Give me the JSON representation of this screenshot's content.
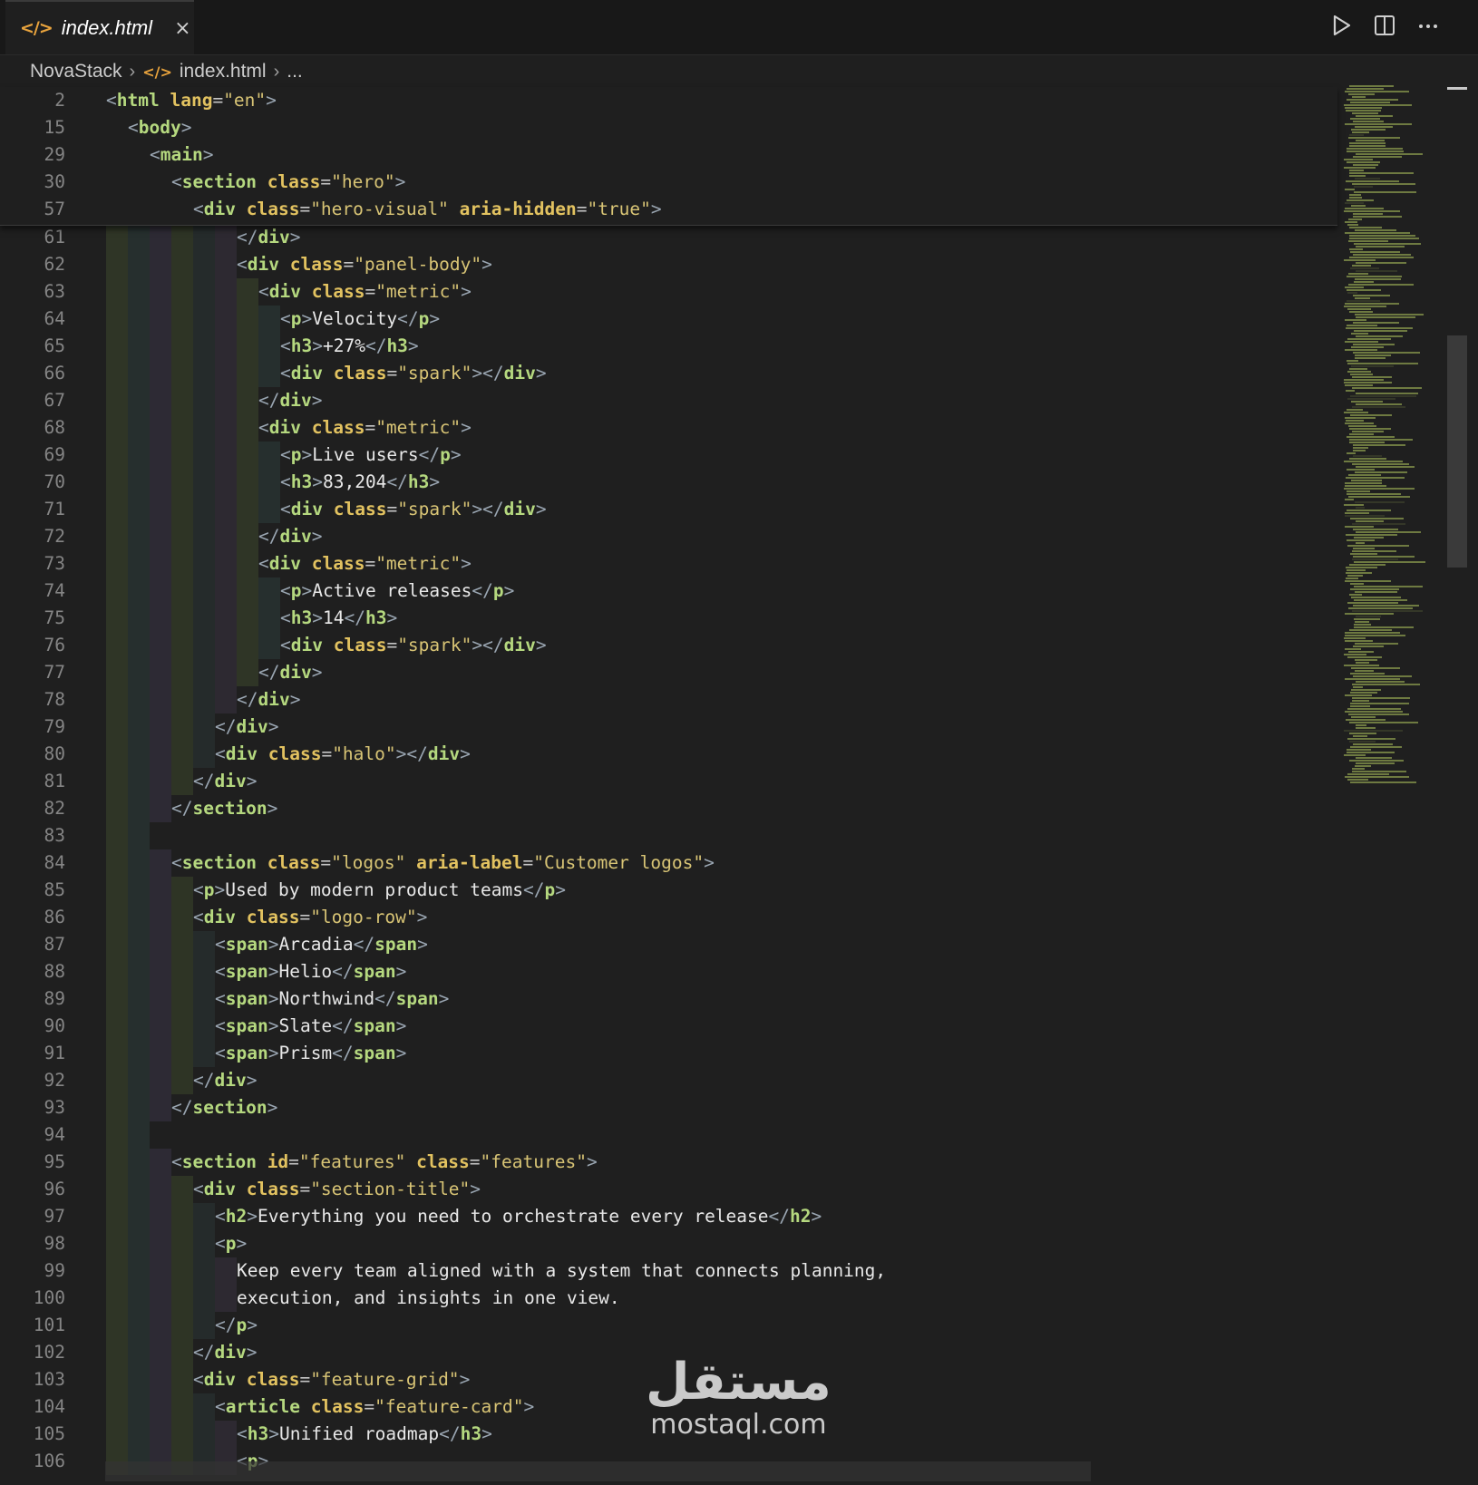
{
  "tab": {
    "icon": "html-file-icon",
    "label": "index.html",
    "close": "×"
  },
  "breadcrumb": {
    "project": "NovaStack",
    "file": "index.html",
    "more": "..."
  },
  "actions": [
    "run-icon",
    "split-editor-icon",
    "more-actions-icon"
  ],
  "sticky_lines": [
    {
      "n": "2",
      "html": "<span class='br'>&lt;</span><span class='tag'>html</span> <span class='at'>lang</span><span class='eq'>=</span><span class='st'>\"en\"</span><span class='br'>&gt;</span>",
      "indent": 0
    },
    {
      "n": "15",
      "html": "<span class='br'>&lt;</span><span class='tag'>body</span><span class='br'>&gt;</span>",
      "indent": 1
    },
    {
      "n": "29",
      "html": "<span class='br'>&lt;</span><span class='tag'>main</span><span class='br'>&gt;</span>",
      "indent": 2
    },
    {
      "n": "30",
      "html": "<span class='br'>&lt;</span><span class='tag'>section</span> <span class='at'>class</span><span class='eq'>=</span><span class='st'>\"hero\"</span><span class='br'>&gt;</span>",
      "indent": 3
    },
    {
      "n": "57",
      "html": "<span class='br'>&lt;</span><span class='tag'>div</span> <span class='at'>class</span><span class='eq'>=</span><span class='st'>\"hero-visual\"</span> <span class='at'>aria-hidden</span><span class='eq'>=</span><span class='st'>\"true\"</span><span class='br'>&gt;</span>",
      "indent": 4
    }
  ],
  "lines": [
    {
      "n": "61",
      "indent": 6,
      "guides": 6,
      "html": "<span class='br'>&lt;/</span><span class='tag'>div</span><span class='br'>&gt;</span>"
    },
    {
      "n": "62",
      "indent": 6,
      "guides": 6,
      "html": "<span class='br'>&lt;</span><span class='tag'>div</span> <span class='at'>class</span><span class='eq'>=</span><span class='st'>\"panel-body\"</span><span class='br'>&gt;</span>"
    },
    {
      "n": "63",
      "indent": 7,
      "guides": 7,
      "html": "<span class='br'>&lt;</span><span class='tag'>div</span> <span class='at'>class</span><span class='eq'>=</span><span class='st'>\"metric\"</span><span class='br'>&gt;</span>"
    },
    {
      "n": "64",
      "indent": 8,
      "guides": 8,
      "html": "<span class='br'>&lt;</span><span class='tag'>p</span><span class='br'>&gt;</span><span class='tx'>Velocity</span><span class='br'>&lt;/</span><span class='tag'>p</span><span class='br'>&gt;</span>"
    },
    {
      "n": "65",
      "indent": 8,
      "guides": 8,
      "html": "<span class='br'>&lt;</span><span class='tag'>h3</span><span class='br'>&gt;</span><span class='tx'>+27%</span><span class='br'>&lt;/</span><span class='tag'>h3</span><span class='br'>&gt;</span>"
    },
    {
      "n": "66",
      "indent": 8,
      "guides": 8,
      "html": "<span class='br'>&lt;</span><span class='tag'>div</span> <span class='at'>class</span><span class='eq'>=</span><span class='st'>\"spark\"</span><span class='br'>&gt;&lt;/</span><span class='tag'>div</span><span class='br'>&gt;</span>"
    },
    {
      "n": "67",
      "indent": 7,
      "guides": 7,
      "html": "<span class='br'>&lt;/</span><span class='tag'>div</span><span class='br'>&gt;</span>"
    },
    {
      "n": "68",
      "indent": 7,
      "guides": 7,
      "html": "<span class='br'>&lt;</span><span class='tag'>div</span> <span class='at'>class</span><span class='eq'>=</span><span class='st'>\"metric\"</span><span class='br'>&gt;</span>"
    },
    {
      "n": "69",
      "indent": 8,
      "guides": 8,
      "html": "<span class='br'>&lt;</span><span class='tag'>p</span><span class='br'>&gt;</span><span class='tx'>Live users</span><span class='br'>&lt;/</span><span class='tag'>p</span><span class='br'>&gt;</span>"
    },
    {
      "n": "70",
      "indent": 8,
      "guides": 8,
      "html": "<span class='br'>&lt;</span><span class='tag'>h3</span><span class='br'>&gt;</span><span class='tx'>83,204</span><span class='br'>&lt;/</span><span class='tag'>h3</span><span class='br'>&gt;</span>"
    },
    {
      "n": "71",
      "indent": 8,
      "guides": 8,
      "html": "<span class='br'>&lt;</span><span class='tag'>div</span> <span class='at'>class</span><span class='eq'>=</span><span class='st'>\"spark\"</span><span class='br'>&gt;&lt;/</span><span class='tag'>div</span><span class='br'>&gt;</span>"
    },
    {
      "n": "72",
      "indent": 7,
      "guides": 7,
      "html": "<span class='br'>&lt;/</span><span class='tag'>div</span><span class='br'>&gt;</span>"
    },
    {
      "n": "73",
      "indent": 7,
      "guides": 7,
      "html": "<span class='br'>&lt;</span><span class='tag'>div</span> <span class='at'>class</span><span class='eq'>=</span><span class='st'>\"metric\"</span><span class='br'>&gt;</span>"
    },
    {
      "n": "74",
      "indent": 8,
      "guides": 8,
      "html": "<span class='br'>&lt;</span><span class='tag'>p</span><span class='br'>&gt;</span><span class='tx'>Active releases</span><span class='br'>&lt;/</span><span class='tag'>p</span><span class='br'>&gt;</span>"
    },
    {
      "n": "75",
      "indent": 8,
      "guides": 8,
      "html": "<span class='br'>&lt;</span><span class='tag'>h3</span><span class='br'>&gt;</span><span class='tx'>14</span><span class='br'>&lt;/</span><span class='tag'>h3</span><span class='br'>&gt;</span>"
    },
    {
      "n": "76",
      "indent": 8,
      "guides": 8,
      "html": "<span class='br'>&lt;</span><span class='tag'>div</span> <span class='at'>class</span><span class='eq'>=</span><span class='st'>\"spark\"</span><span class='br'>&gt;&lt;/</span><span class='tag'>div</span><span class='br'>&gt;</span>"
    },
    {
      "n": "77",
      "indent": 7,
      "guides": 7,
      "html": "<span class='br'>&lt;/</span><span class='tag'>div</span><span class='br'>&gt;</span>"
    },
    {
      "n": "78",
      "indent": 6,
      "guides": 6,
      "html": "<span class='br'>&lt;/</span><span class='tag'>div</span><span class='br'>&gt;</span>"
    },
    {
      "n": "79",
      "indent": 5,
      "guides": 5,
      "html": "<span class='br'>&lt;/</span><span class='tag'>div</span><span class='br'>&gt;</span>"
    },
    {
      "n": "80",
      "indent": 5,
      "guides": 5,
      "html": "<span class='br'>&lt;</span><span class='tag'>div</span> <span class='at'>class</span><span class='eq'>=</span><span class='st'>\"halo\"</span><span class='br'>&gt;&lt;/</span><span class='tag'>div</span><span class='br'>&gt;</span>"
    },
    {
      "n": "81",
      "indent": 4,
      "guides": 4,
      "html": "<span class='br'>&lt;/</span><span class='tag'>div</span><span class='br'>&gt;</span>"
    },
    {
      "n": "82",
      "indent": 3,
      "guides": 3,
      "html": "<span class='br'>&lt;/</span><span class='tag'>section</span><span class='br'>&gt;</span>"
    },
    {
      "n": "83",
      "indent": 0,
      "guides": 2,
      "html": ""
    },
    {
      "n": "84",
      "indent": 3,
      "guides": 3,
      "html": "<span class='br'>&lt;</span><span class='tag'>section</span> <span class='at'>class</span><span class='eq'>=</span><span class='st'>\"logos\"</span> <span class='at'>aria-label</span><span class='eq'>=</span><span class='st'>\"Customer logos\"</span><span class='br'>&gt;</span>"
    },
    {
      "n": "85",
      "indent": 4,
      "guides": 4,
      "html": "<span class='br'>&lt;</span><span class='tag'>p</span><span class='br'>&gt;</span><span class='tx'>Used by modern product teams</span><span class='br'>&lt;/</span><span class='tag'>p</span><span class='br'>&gt;</span>"
    },
    {
      "n": "86",
      "indent": 4,
      "guides": 4,
      "html": "<span class='br'>&lt;</span><span class='tag'>div</span> <span class='at'>class</span><span class='eq'>=</span><span class='st'>\"logo-row\"</span><span class='br'>&gt;</span>"
    },
    {
      "n": "87",
      "indent": 5,
      "guides": 5,
      "html": "<span class='br'>&lt;</span><span class='tag'>span</span><span class='br'>&gt;</span><span class='tx'>Arcadia</span><span class='br'>&lt;/</span><span class='tag'>span</span><span class='br'>&gt;</span>"
    },
    {
      "n": "88",
      "indent": 5,
      "guides": 5,
      "html": "<span class='br'>&lt;</span><span class='tag'>span</span><span class='br'>&gt;</span><span class='tx'>Helio</span><span class='br'>&lt;/</span><span class='tag'>span</span><span class='br'>&gt;</span>"
    },
    {
      "n": "89",
      "indent": 5,
      "guides": 5,
      "html": "<span class='br'>&lt;</span><span class='tag'>span</span><span class='br'>&gt;</span><span class='tx'>Northwind</span><span class='br'>&lt;/</span><span class='tag'>span</span><span class='br'>&gt;</span>"
    },
    {
      "n": "90",
      "indent": 5,
      "guides": 5,
      "html": "<span class='br'>&lt;</span><span class='tag'>span</span><span class='br'>&gt;</span><span class='tx'>Slate</span><span class='br'>&lt;/</span><span class='tag'>span</span><span class='br'>&gt;</span>"
    },
    {
      "n": "91",
      "indent": 5,
      "guides": 5,
      "html": "<span class='br'>&lt;</span><span class='tag'>span</span><span class='br'>&gt;</span><span class='tx'>Prism</span><span class='br'>&lt;/</span><span class='tag'>span</span><span class='br'>&gt;</span>"
    },
    {
      "n": "92",
      "indent": 4,
      "guides": 4,
      "html": "<span class='br'>&lt;/</span><span class='tag'>div</span><span class='br'>&gt;</span>"
    },
    {
      "n": "93",
      "indent": 3,
      "guides": 3,
      "html": "<span class='br'>&lt;/</span><span class='tag'>section</span><span class='br'>&gt;</span>"
    },
    {
      "n": "94",
      "indent": 0,
      "guides": 2,
      "html": ""
    },
    {
      "n": "95",
      "indent": 3,
      "guides": 3,
      "html": "<span class='br'>&lt;</span><span class='tag'>section</span> <span class='at'>id</span><span class='eq'>=</span><span class='st'>\"features\"</span> <span class='at'>class</span><span class='eq'>=</span><span class='st'>\"features\"</span><span class='br'>&gt;</span>"
    },
    {
      "n": "96",
      "indent": 4,
      "guides": 4,
      "html": "<span class='br'>&lt;</span><span class='tag'>div</span> <span class='at'>class</span><span class='eq'>=</span><span class='st'>\"section-title\"</span><span class='br'>&gt;</span>"
    },
    {
      "n": "97",
      "indent": 5,
      "guides": 5,
      "html": "<span class='br'>&lt;</span><span class='tag'>h2</span><span class='br'>&gt;</span><span class='tx'>Everything you need to orchestrate every release</span><span class='br'>&lt;/</span><span class='tag'>h2</span><span class='br'>&gt;</span>"
    },
    {
      "n": "98",
      "indent": 5,
      "guides": 5,
      "html": "<span class='br'>&lt;</span><span class='tag'>p</span><span class='br'>&gt;</span>"
    },
    {
      "n": "99",
      "indent": 6,
      "guides": 6,
      "html": "<span class='tx'>Keep every team aligned with a system that connects planning,</span>"
    },
    {
      "n": "100",
      "indent": 6,
      "guides": 6,
      "html": "<span class='tx'>execution, and insights in one view.</span>"
    },
    {
      "n": "101",
      "indent": 5,
      "guides": 5,
      "html": "<span class='br'>&lt;/</span><span class='tag'>p</span><span class='br'>&gt;</span>"
    },
    {
      "n": "102",
      "indent": 4,
      "guides": 4,
      "html": "<span class='br'>&lt;/</span><span class='tag'>div</span><span class='br'>&gt;</span>"
    },
    {
      "n": "103",
      "indent": 4,
      "guides": 4,
      "html": "<span class='br'>&lt;</span><span class='tag'>div</span> <span class='at'>class</span><span class='eq'>=</span><span class='st'>\"feature-grid\"</span><span class='br'>&gt;</span>"
    },
    {
      "n": "104",
      "indent": 5,
      "guides": 5,
      "html": "<span class='br'>&lt;</span><span class='tag'>article</span> <span class='at'>class</span><span class='eq'>=</span><span class='st'>\"feature-card\"</span><span class='br'>&gt;</span>"
    },
    {
      "n": "105",
      "indent": 6,
      "guides": 6,
      "html": "<span class='br'>&lt;</span><span class='tag'>h3</span><span class='br'>&gt;</span><span class='tx'>Unified roadmap</span><span class='br'>&lt;/</span><span class='tag'>h3</span><span class='br'>&gt;</span>"
    },
    {
      "n": "106",
      "indent": 6,
      "guides": 6,
      "html": "<span class='br'>&lt;</span><span class='tag'>p</span><span class='br'>&gt;</span>"
    }
  ],
  "watermark": {
    "arabic": "مستقل",
    "latin": "mostaql.com"
  }
}
